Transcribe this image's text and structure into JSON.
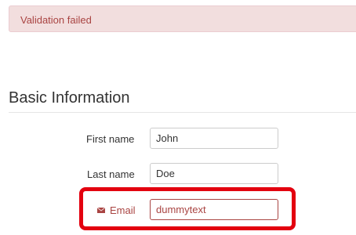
{
  "alert": {
    "message": "Validation failed"
  },
  "section": {
    "title": "Basic Information"
  },
  "form": {
    "first_name": {
      "label": "First name",
      "value": "John"
    },
    "last_name": {
      "label": "Last name",
      "value": "Doe"
    },
    "email": {
      "label": "Email",
      "value": "dummytext",
      "icon": "envelope-icon"
    }
  },
  "colors": {
    "error": "#a94442",
    "alert_background": "#f2dede",
    "highlight": "#e3000f"
  }
}
